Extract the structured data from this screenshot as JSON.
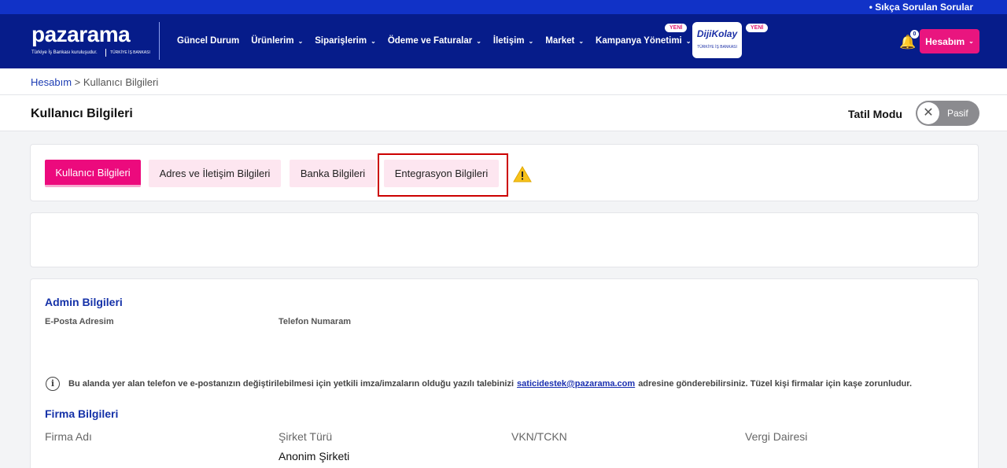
{
  "topbar": {
    "faq": "• Sıkça Sorulan Sorular"
  },
  "logo": {
    "word": "pazarama",
    "tagline": "Türkiye İş Bankası kuruluşudur.",
    "bank": "TÜRKİYE İŞ BANKASI"
  },
  "nav": {
    "items": [
      {
        "label": "Güncel Durum",
        "dropdown": false
      },
      {
        "label": "Ürünlerim",
        "dropdown": true
      },
      {
        "label": "Siparişlerim",
        "dropdown": true
      },
      {
        "label": "Ödeme ve Faturalar",
        "dropdown": true
      },
      {
        "label": "İletişim",
        "dropdown": true
      },
      {
        "label": "Market",
        "dropdown": true
      },
      {
        "label": "Kampanya Yönetimi",
        "dropdown": true
      }
    ],
    "new_badge": "YENİ",
    "dijikolay": {
      "title": "DijiKolay",
      "subtitle": "TÜRKİYE İŞ BANKASI"
    },
    "notification_count": "0",
    "account": "Hesabım"
  },
  "breadcrumb": {
    "parent": "Hesabım",
    "separator": ">",
    "current": "Kullanıcı Bilgileri"
  },
  "page": {
    "title": "Kullanıcı Bilgileri",
    "vacation_label": "Tatil Modu",
    "vacation_state": "Pasif"
  },
  "tabs": [
    {
      "label": "Kullanıcı Bilgileri",
      "active": true
    },
    {
      "label": "Adres ve İletişim Bilgileri",
      "active": false
    },
    {
      "label": "Banka Bilgileri",
      "active": false
    },
    {
      "label": "Entegrasyon Bilgileri",
      "active": false
    }
  ],
  "admin": {
    "title": "Admin Bilgileri",
    "email_label": "E-Posta Adresim",
    "phone_label": "Telefon Numaram",
    "info_before": "Bu alanda yer alan telefon ve e-postanızın değiştirilebilmesi için yetkili imza/imzaların olduğu yazılı talebinizi",
    "info_email": "saticidestek@pazarama.com",
    "info_after": "adresine gönderebilirsiniz. Tüzel kişi firmalar için kaşe zorunludur."
  },
  "firm": {
    "title": "Firma Bilgileri",
    "name_label": "Firma Adı",
    "type_label": "Şirket Türü",
    "type_value": "Anonim Şirketi",
    "tax_label": "VKN/TCKN",
    "office_label": "Vergi Dairesi"
  },
  "colors": {
    "brand_navy": "#061c8a",
    "accent_pink": "#ec0a7d",
    "link_blue": "#1431a8"
  }
}
